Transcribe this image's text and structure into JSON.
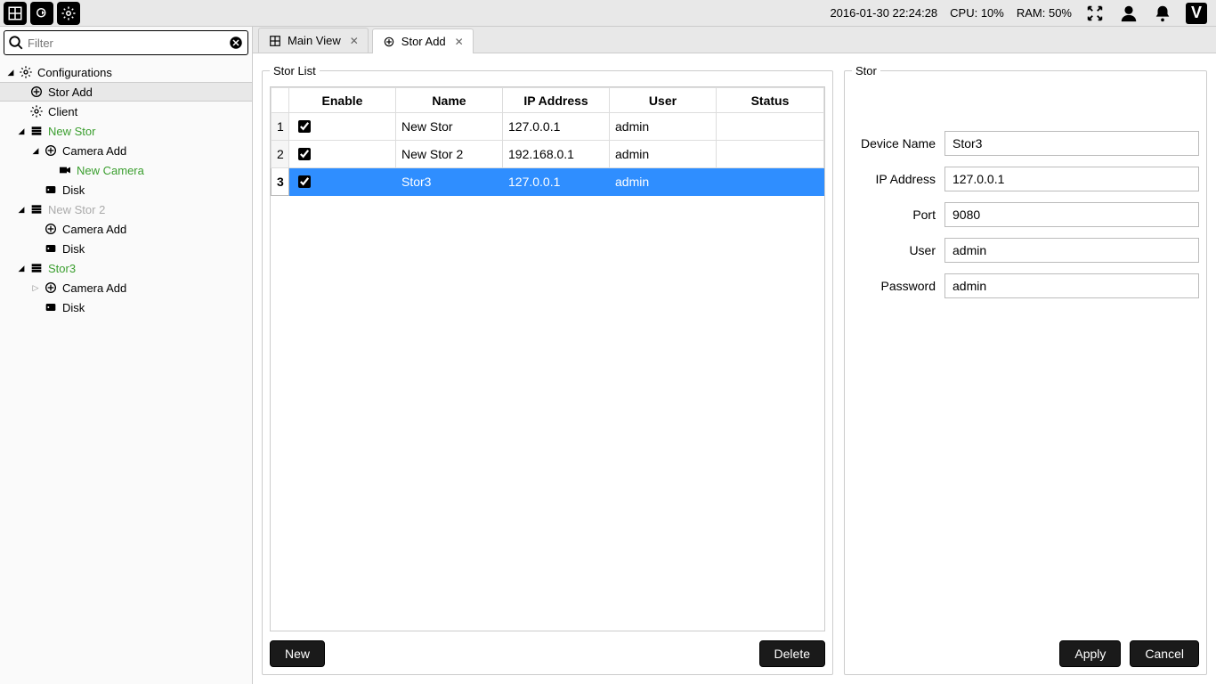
{
  "topbar": {
    "datetime": "2016-01-30 22:24:28",
    "cpu": "CPU: 10%",
    "ram": "RAM: 50%"
  },
  "filter": {
    "placeholder": "Filter"
  },
  "tree": {
    "configurations": "Configurations",
    "stor_add": "Stor Add",
    "client": "Client",
    "new_stor": "New Stor",
    "camera_add": "Camera Add",
    "new_camera": "New Camera",
    "disk": "Disk",
    "new_stor2": "New Stor 2",
    "camera_add2": "Camera Add",
    "disk2": "Disk",
    "stor3": "Stor3",
    "camera_add3": "Camera Add",
    "disk3": "Disk"
  },
  "tabs": {
    "main_view": "Main View",
    "stor_add": "Stor Add"
  },
  "list": {
    "legend": "Stor List",
    "headers": {
      "enable": "Enable",
      "name": "Name",
      "ip": "IP Address",
      "user": "User",
      "status": "Status"
    },
    "rows": [
      {
        "n": "1",
        "name": "New Stor",
        "ip": "127.0.0.1",
        "user": "admin",
        "status": ""
      },
      {
        "n": "2",
        "name": "New Stor 2",
        "ip": "192.168.0.1",
        "user": "admin",
        "status": ""
      },
      {
        "n": "3",
        "name": "Stor3",
        "ip": "127.0.0.1",
        "user": "admin",
        "status": ""
      }
    ],
    "new_btn": "New",
    "delete_btn": "Delete"
  },
  "form": {
    "legend": "Stor",
    "device_name_label": "Device Name",
    "device_name": "Stor3",
    "ip_label": "IP Address",
    "ip": "127.0.0.1",
    "port_label": "Port",
    "port": "9080",
    "user_label": "User",
    "user": "admin",
    "password_label": "Password",
    "password": "admin",
    "apply": "Apply",
    "cancel": "Cancel"
  }
}
